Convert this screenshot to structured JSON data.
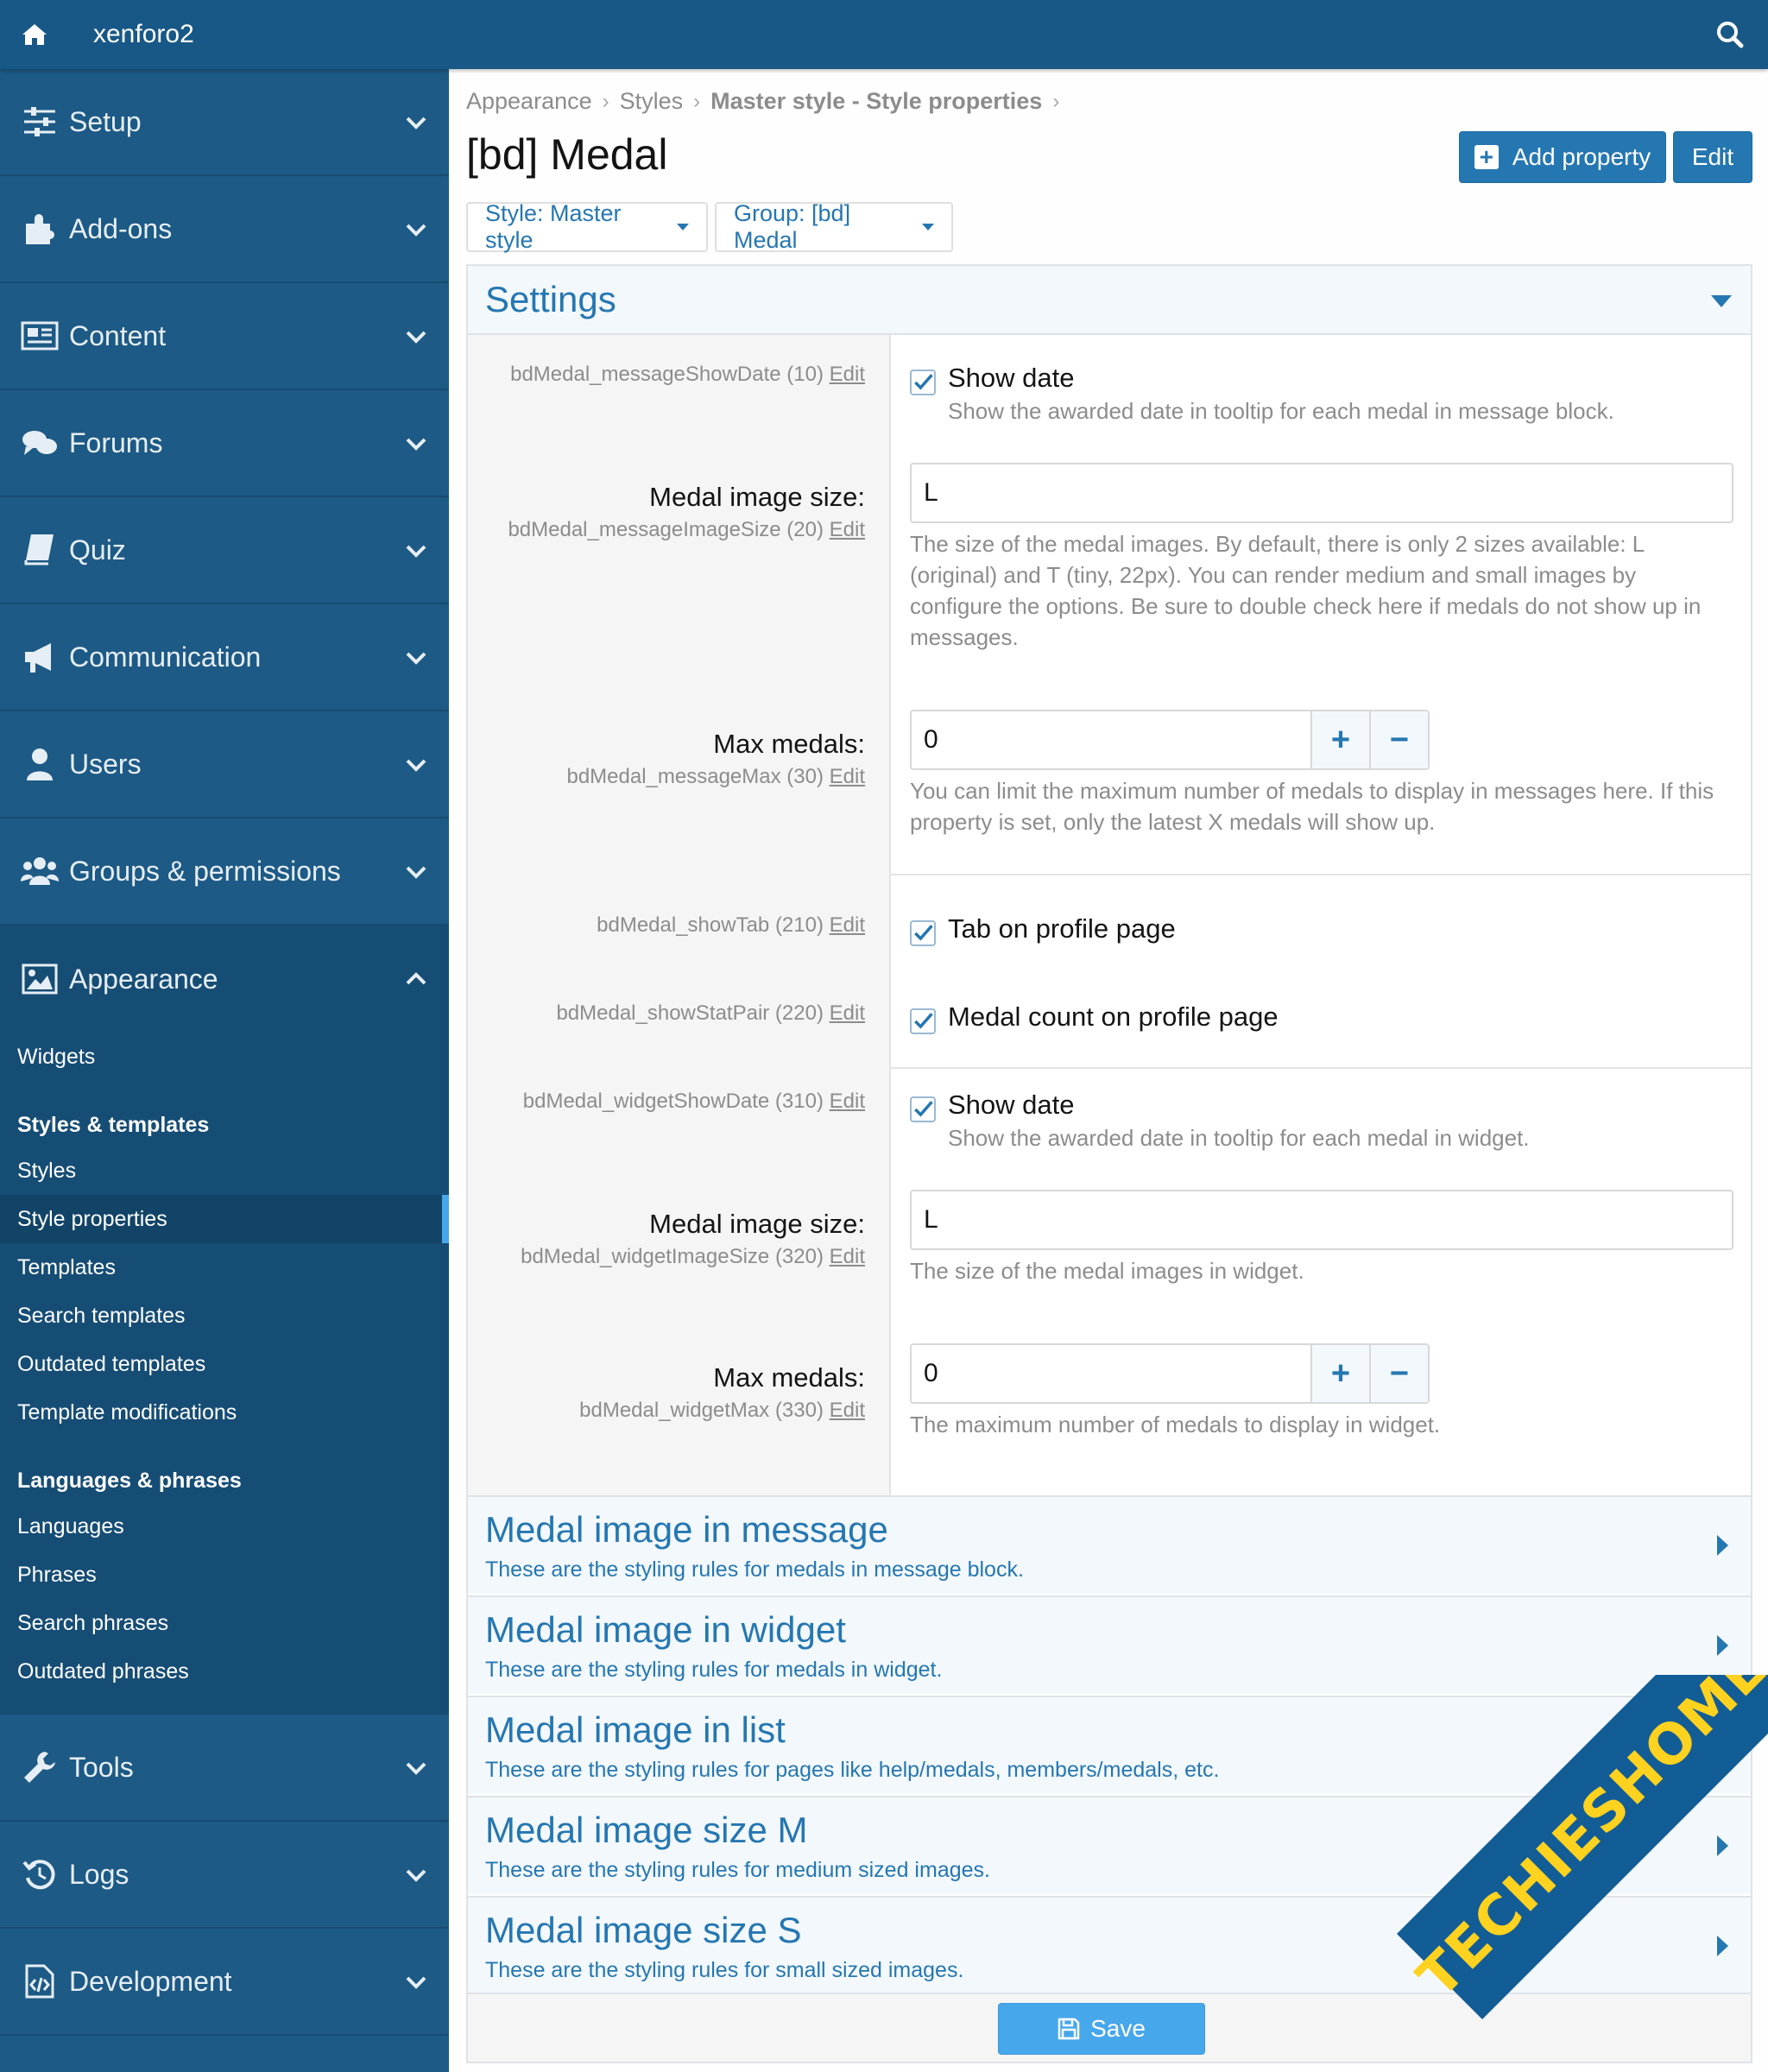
{
  "header": {
    "brand": "xenforo2"
  },
  "sidebar": {
    "sections": [
      {
        "label": "Setup",
        "icon": "sliders-icon"
      },
      {
        "label": "Add-ons",
        "icon": "puzzle-icon"
      },
      {
        "label": "Content",
        "icon": "newspaper-icon"
      },
      {
        "label": "Forums",
        "icon": "comments-icon"
      },
      {
        "label": "Quiz",
        "icon": "book-icon"
      },
      {
        "label": "Communication",
        "icon": "bullhorn-icon"
      },
      {
        "label": "Users",
        "icon": "user-icon"
      },
      {
        "label": "Groups & permissions",
        "icon": "users-icon"
      },
      {
        "label": "Appearance",
        "icon": "image-icon"
      },
      {
        "label": "Tools",
        "icon": "wrench-icon"
      },
      {
        "label": "Logs",
        "icon": "history-icon"
      },
      {
        "label": "Development",
        "icon": "code-file-icon"
      }
    ],
    "appearance": {
      "widgets": "Widgets",
      "styles_head": "Styles & templates",
      "styles_items": [
        "Styles",
        "Style properties",
        "Templates",
        "Search templates",
        "Outdated templates",
        "Template modifications"
      ],
      "lang_head": "Languages & phrases",
      "lang_items": [
        "Languages",
        "Phrases",
        "Search phrases",
        "Outdated phrases"
      ]
    }
  },
  "breadcrumb": [
    "Appearance",
    "Styles",
    "Master style - Style properties"
  ],
  "page": {
    "title": "[bd] Medal",
    "add_property": "Add property",
    "edit": "Edit",
    "filter_style": "Style: Master style",
    "filter_group": "Group: [bd] Medal"
  },
  "settings": {
    "title": "Settings",
    "rows": {
      "msg_show_date": {
        "key": "bdMedal_messageShowDate (10)",
        "edit": "Edit",
        "check_label": "Show date",
        "hint": "Show the awarded date in tooltip for each medal in message block.",
        "checked": true
      },
      "msg_image_size": {
        "label": "Medal image size:",
        "key": "bdMedal_messageImageSize (20)",
        "edit": "Edit",
        "value": "L",
        "hint": "The size of the medal images. By default, there is only 2 sizes available: L (original) and T (tiny, 22px). You can render medium and small images by configure the options. Be sure to double check here if medals do not show up in messages."
      },
      "msg_max": {
        "label": "Max medals:",
        "key": "bdMedal_messageMax (30)",
        "edit": "Edit",
        "value": "0",
        "hint": "You can limit the maximum number of medals to display in messages here. If this property is set, only the latest X medals will show up."
      },
      "show_tab": {
        "key": "bdMedal_showTab (210)",
        "edit": "Edit",
        "check_label": "Tab on profile page",
        "checked": true
      },
      "show_stat": {
        "key": "bdMedal_showStatPair (220)",
        "edit": "Edit",
        "check_label": "Medal count on profile page",
        "checked": true
      },
      "widget_show_date": {
        "key": "bdMedal_widgetShowDate (310)",
        "edit": "Edit",
        "check_label": "Show date",
        "hint": "Show the awarded date in tooltip for each medal in widget.",
        "checked": true
      },
      "widget_image_size": {
        "label": "Medal image size:",
        "key": "bdMedal_widgetImageSize (320)",
        "edit": "Edit",
        "value": "L",
        "hint": "The size of the medal images in widget."
      },
      "widget_max": {
        "label": "Max medals:",
        "key": "bdMedal_widgetMax (330)",
        "edit": "Edit",
        "value": "0",
        "hint": "The maximum number of medals to display in widget."
      }
    },
    "plus": "+",
    "minus": "−"
  },
  "groups": [
    {
      "title": "Medal image in message",
      "desc": "These are the styling rules for medals in message block."
    },
    {
      "title": "Medal image in widget",
      "desc": "These are the styling rules for medals in widget."
    },
    {
      "title": "Medal image in list",
      "desc": "These are the styling rules for pages like help/medals, members/medals, etc."
    },
    {
      "title": "Medal image size M",
      "desc": "These are the styling rules for medium sized images."
    },
    {
      "title": "Medal image size S",
      "desc": "These are the styling rules for small sized images."
    }
  ],
  "save": "Save",
  "watermark": "TECHIESHOME.COM",
  "colors": {
    "header": "#185886",
    "sidebar": "#1d5a85",
    "primary": "#2577b1",
    "save": "#47a7eb",
    "watermark_text": "#ffd21f"
  }
}
